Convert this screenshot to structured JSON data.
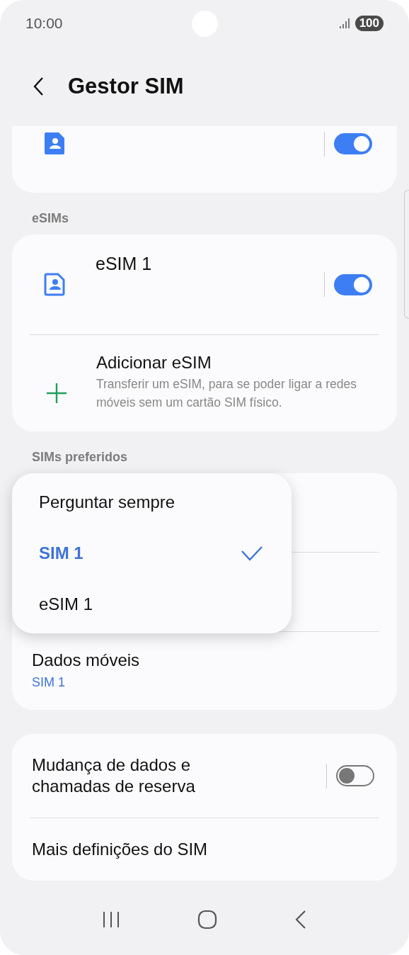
{
  "status_bar": {
    "time": "10:00",
    "battery": "100"
  },
  "header": {
    "title": "Gestor SIM"
  },
  "sim_card": {
    "on": true
  },
  "esims": {
    "heading": "eSIMs",
    "items": [
      {
        "name": "eSIM 1",
        "on": true
      }
    ],
    "add": {
      "title": "Adicionar eSIM",
      "description": "Transferir um eSIM, para se poder ligar a redes móveis sem um cartão SIM físico."
    }
  },
  "preferred": {
    "heading": "SIMs preferidos",
    "rows": [
      {
        "title": "Dados móveis",
        "value": "SIM 1"
      }
    ]
  },
  "menu": {
    "options": [
      {
        "label": "Perguntar sempre",
        "selected": false
      },
      {
        "label": "SIM 1",
        "selected": true
      },
      {
        "label": "eSIM 1",
        "selected": false
      }
    ]
  },
  "more": {
    "rows": [
      {
        "kind": "toggle",
        "title": "Mudança de dados e chamadas de reserva",
        "on": false
      },
      {
        "kind": "link",
        "title": "Mais definições do SIM"
      }
    ]
  }
}
